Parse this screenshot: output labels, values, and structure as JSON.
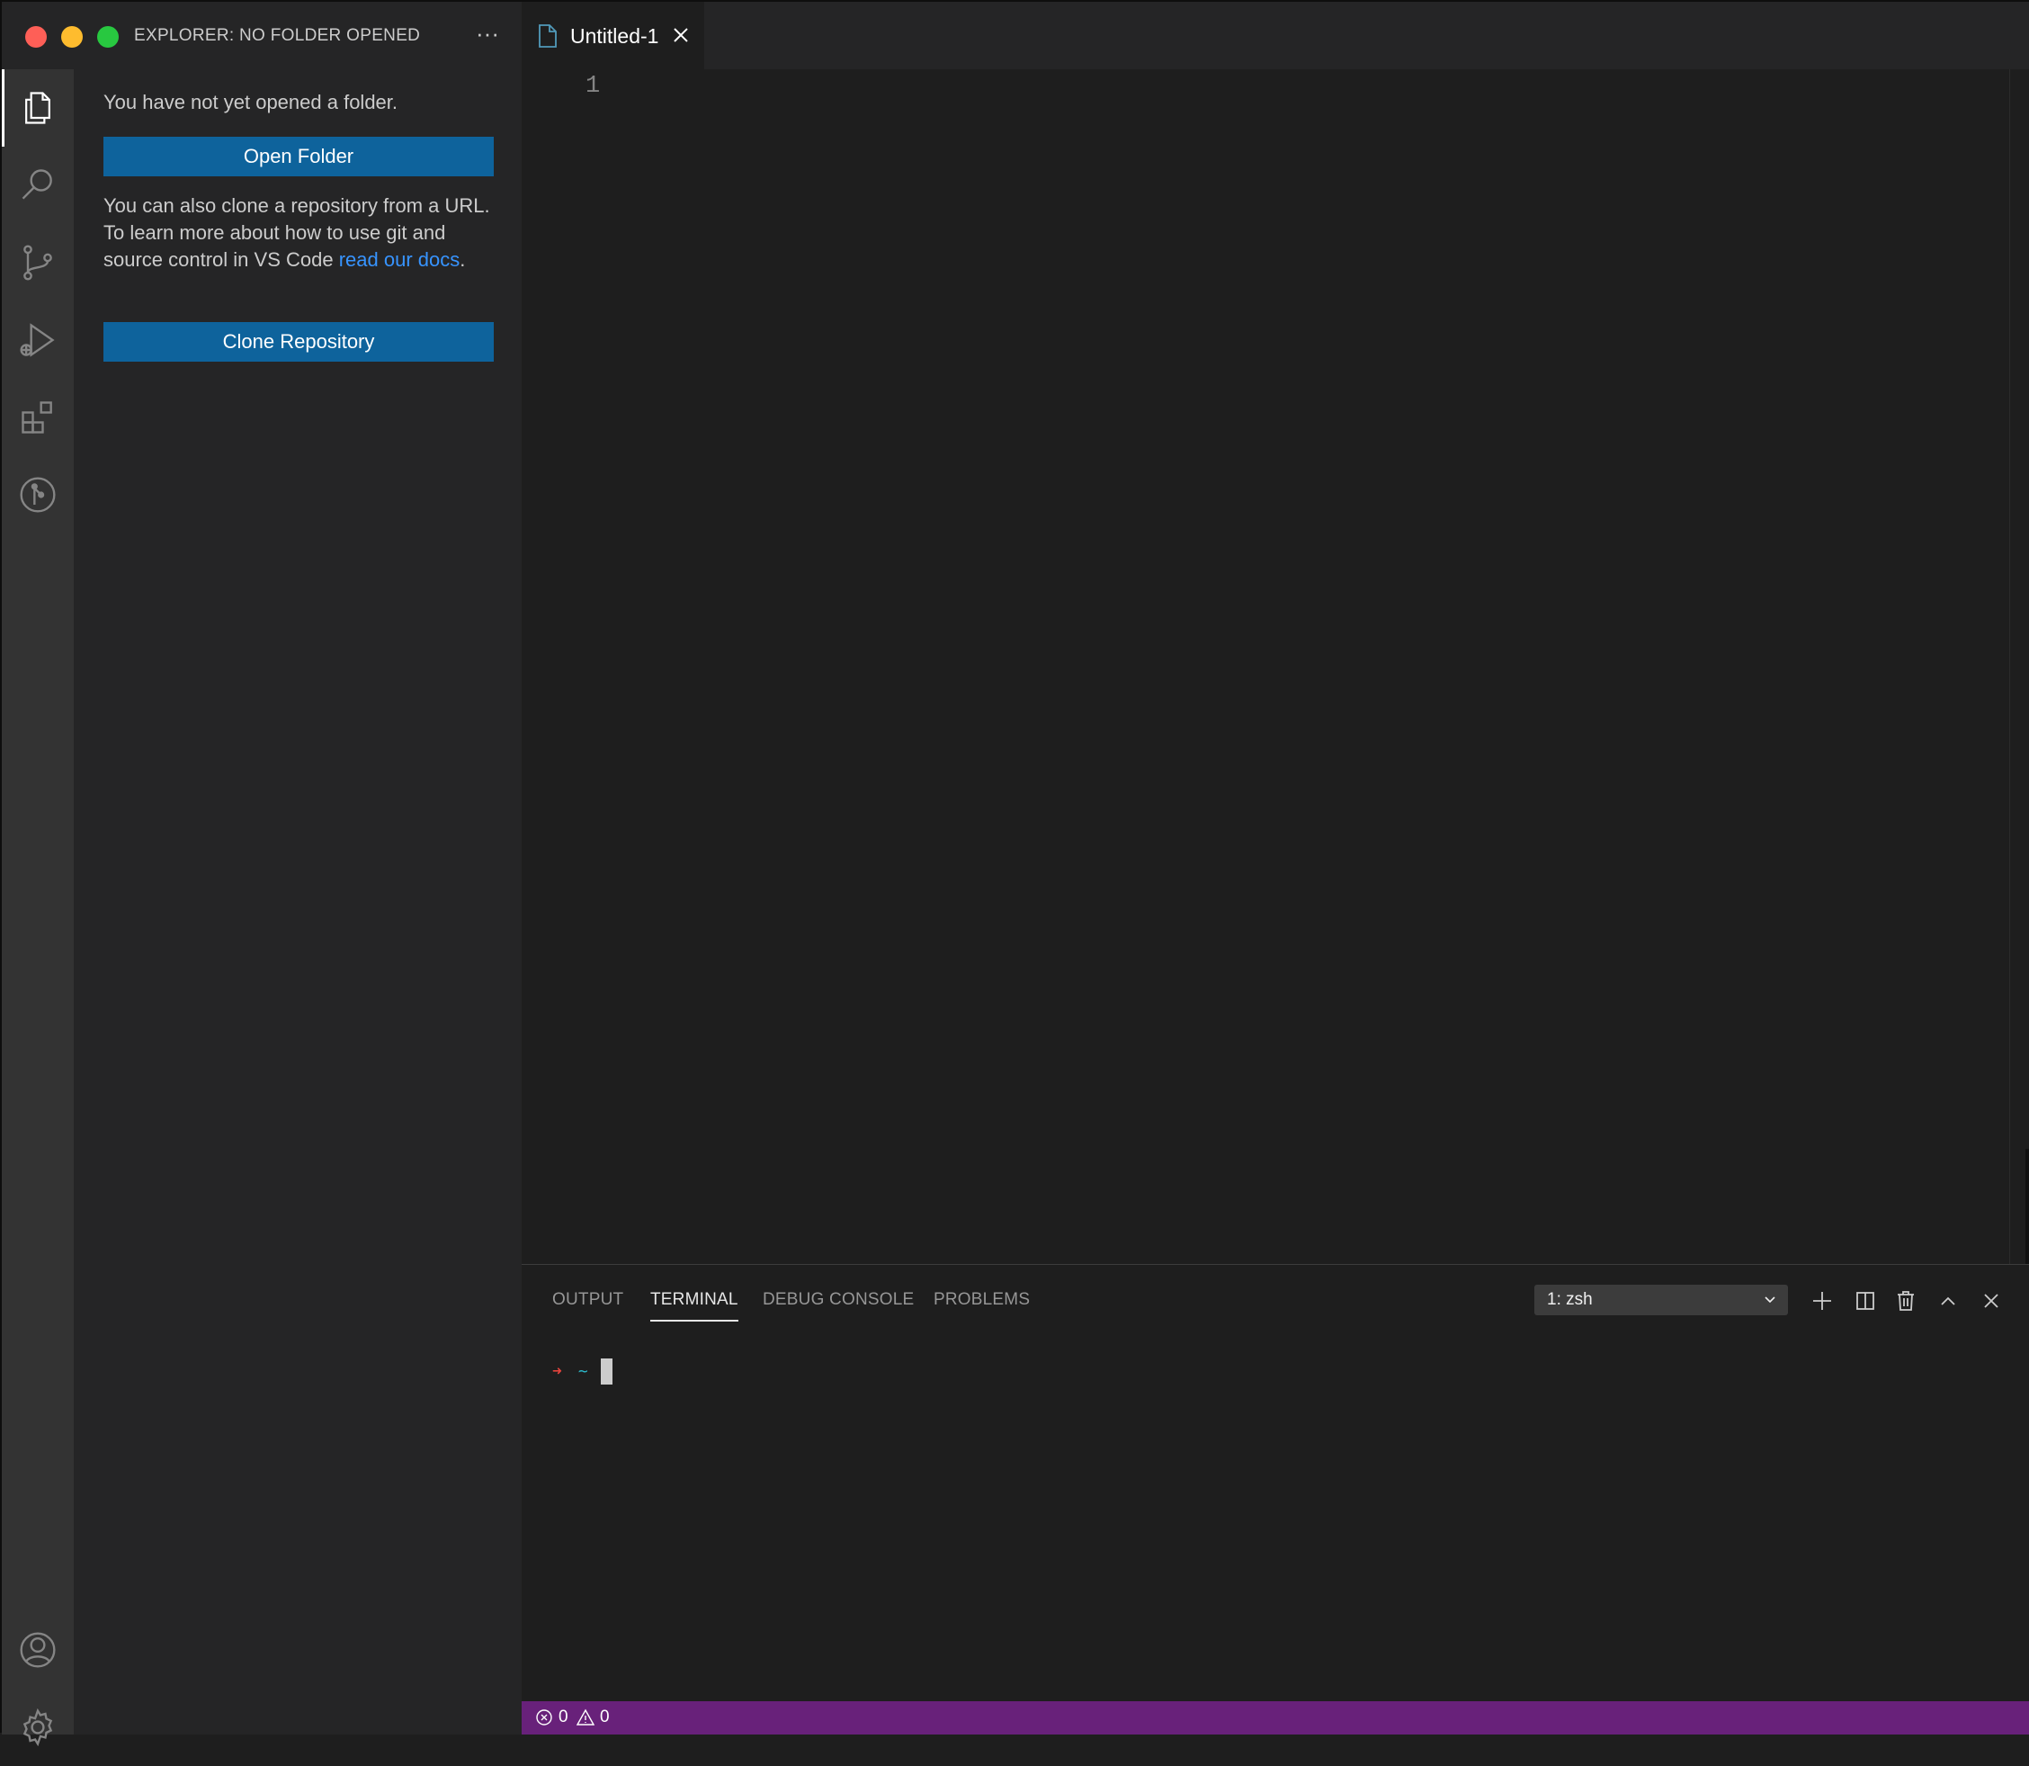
{
  "window": {
    "traffic_lights": [
      "close",
      "minimize",
      "zoom"
    ]
  },
  "sidebar": {
    "title": "EXPLORER: NO FOLDER OPENED",
    "more_actions": "···",
    "no_folder_message": "You have not yet opened a folder.",
    "open_folder_label": "Open Folder",
    "clone_message_prefix": "You can also clone a repository from a URL. To learn more about how to use git and source control in VS Code ",
    "clone_message_link": "read our docs",
    "clone_message_suffix": ".",
    "clone_repository_label": "Clone Repository"
  },
  "activity_bar": {
    "items": [
      "explorer-icon",
      "search-icon",
      "source-control-icon",
      "run-debug-icon",
      "extensions-icon",
      "git-graph-icon"
    ],
    "bottom_items": [
      "account-icon",
      "settings-gear-icon"
    ]
  },
  "editor": {
    "tab_label": "Untitled-1",
    "line_numbers": [
      "1"
    ]
  },
  "panel": {
    "tabs": [
      "OUTPUT",
      "TERMINAL",
      "DEBUG CONSOLE",
      "PROBLEMS"
    ],
    "active_tab": "TERMINAL",
    "terminal_selected": "1: zsh",
    "prompt_arrow": "➜",
    "prompt_dir": "~"
  },
  "status_bar": {
    "errors": "0",
    "warnings": "0"
  },
  "colors": {
    "accent_button": "#0e639c",
    "status_bar": "#68217a",
    "link": "#3794ff"
  }
}
